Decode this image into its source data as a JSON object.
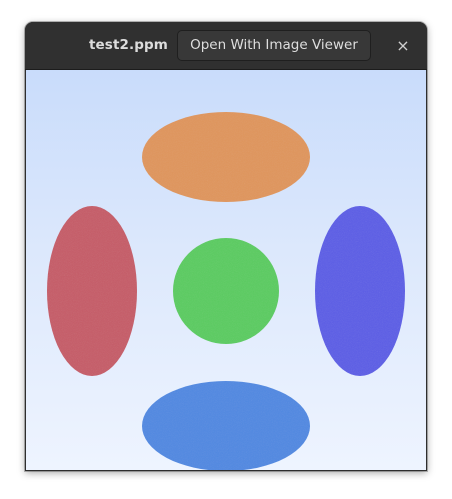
{
  "window": {
    "title": "test2.ppm",
    "open_button_label": "Open With Image Viewer",
    "close_glyph": "×"
  },
  "image": {
    "shapes": [
      {
        "name": "top-ellipse",
        "color": "#e0955a"
      },
      {
        "name": "left-ellipse",
        "color": "#c65a66"
      },
      {
        "name": "center-circle",
        "color": "#58cc5e"
      },
      {
        "name": "right-ellipse",
        "color": "#5a5ce6"
      },
      {
        "name": "bottom-ellipse",
        "color": "#4d88e2"
      }
    ]
  }
}
